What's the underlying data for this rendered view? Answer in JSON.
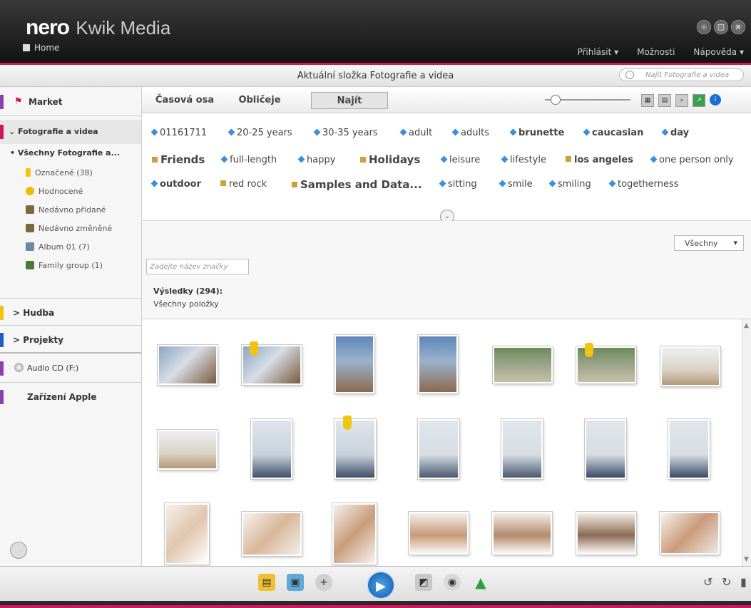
{
  "app": {
    "brand": "nero",
    "product": "Kwik Media",
    "home": "Home"
  },
  "window_controls": [
    "-",
    "□",
    "×"
  ],
  "top_menu": [
    "Přihlásit",
    "Možnosti",
    "Nápověda"
  ],
  "folder_bar": {
    "title": "Aktuální složka Fotografie a videa",
    "search_placeholder": "Najít Fotografie a videa"
  },
  "sidebar": {
    "market": "Market",
    "photos": "Fotografie a videa",
    "all_photos": "Všechny Fotografie a...",
    "subitems": [
      "Označené (38)",
      "Hodnocené",
      "Nedávno přidané",
      "Nedávno změněné",
      "Album 01 (7)",
      "Family group (1)"
    ],
    "music": "Hudba",
    "projects": "Projekty",
    "audio_cd": "Audio CD (F:)",
    "apple": "Zařízení Apple"
  },
  "tabs": [
    "Časová osa",
    "Obličeje",
    "Najít"
  ],
  "tags": [
    "01161711",
    "20-25 years",
    "30-35 years",
    "adult",
    "adults",
    "brunette",
    "caucasian",
    "day",
    "Friends",
    "full-length",
    "happy",
    "Holidays",
    "leisure",
    "lifestyle",
    "los angeles",
    "one person only",
    "outdoor",
    "red rock",
    "Samples and Data...",
    "sitting",
    "smile",
    "smiling",
    "togetherness"
  ],
  "filter": {
    "dropdown": "Všechny",
    "tag_placeholder": "Zadejte název značky",
    "results": "Výsledky (294):",
    "all_items": "Všechny položky"
  },
  "colors": {
    "accent": "#d2165c",
    "tag_blue": "#3c8fd6",
    "tag_gold": "#c9a23a"
  },
  "icons": [
    "home-icon",
    "market-icon",
    "flag-icon",
    "star-icon",
    "recent-icon",
    "album-icon",
    "people-icon",
    "cd-icon",
    "search-icon",
    "info-icon",
    "play-icon"
  ]
}
